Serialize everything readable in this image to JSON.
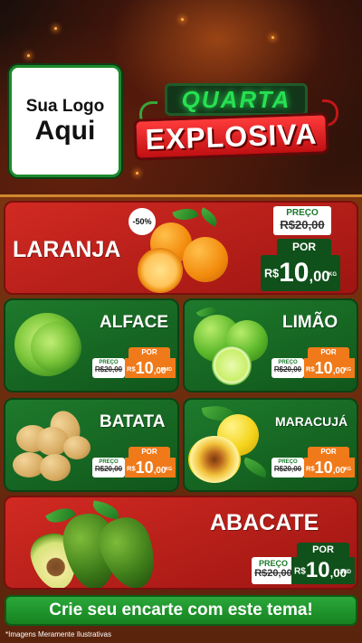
{
  "header": {
    "logo_line1": "Sua Logo",
    "logo_line2": "Aqui",
    "title_top": "QUARTA",
    "title_bottom": "EXPLOSIVA"
  },
  "featured": {
    "name": "LARANJA",
    "discount": "-50%",
    "old_label": "PREÇO",
    "old_price": "R$20,00",
    "por_label": "POR",
    "currency": "R$",
    "price_int": "10",
    "price_dec": ",00",
    "unit": "KG"
  },
  "products": [
    {
      "name": "ALFACE",
      "old_label": "PREÇO",
      "old_price": "R$20,00",
      "por_label": "POR",
      "currency": "R$",
      "price_int": "10",
      "price_dec": ",00",
      "unit": "UNID"
    },
    {
      "name": "LIMÃO",
      "old_label": "PREÇO",
      "old_price": "R$20,00",
      "por_label": "POR",
      "currency": "R$",
      "price_int": "10",
      "price_dec": ",00",
      "unit": "KG"
    },
    {
      "name": "BATATA",
      "old_label": "PREÇO",
      "old_price": "R$20,00",
      "por_label": "POR",
      "currency": "R$",
      "price_int": "10",
      "price_dec": ",00",
      "unit": "KG"
    },
    {
      "name": "MARACUJÁ",
      "old_label": "PREÇO",
      "old_price": "R$20,00",
      "por_label": "POR",
      "currency": "R$",
      "price_int": "10",
      "price_dec": ",00",
      "unit": "KG"
    }
  ],
  "bottom_card": {
    "name": "ABACATE",
    "old_label": "PREÇO",
    "old_price": "R$20,00",
    "por_label": "POR",
    "currency": "R$",
    "price_int": "10",
    "price_dec": ",00",
    "unit": "UNID"
  },
  "footer": {
    "cta": "Crie seu encarte com este tema!",
    "disclaimer": "*Imagens Meramente Ilustrativas"
  },
  "colors": {
    "red": "#c4201b",
    "green": "#1a7028",
    "orange_tag": "#f07a1a",
    "dark_green_tag": "#10501a"
  }
}
